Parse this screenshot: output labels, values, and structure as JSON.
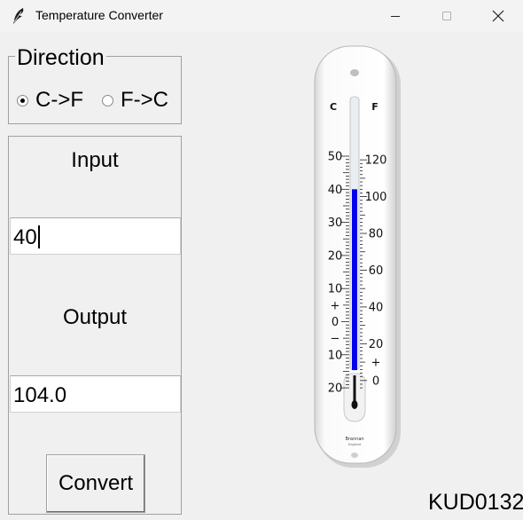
{
  "window": {
    "title": "Temperature Converter",
    "icon": "feather-icon",
    "controls": [
      "minimize-icon",
      "maximize-icon",
      "close-icon"
    ]
  },
  "direction": {
    "legend": "Direction",
    "options": [
      {
        "label": "C->F",
        "checked": true
      },
      {
        "label": "F->C",
        "checked": false
      }
    ]
  },
  "input": {
    "label": "Input",
    "value": "40"
  },
  "output": {
    "label": "Output",
    "value": "104.0"
  },
  "convert_button": {
    "label": "Convert"
  },
  "thermometer": {
    "celsius_unit": "C",
    "fahrenheit_unit": "F",
    "celsius_ticks": [
      "50",
      "40",
      "30",
      "20",
      "10",
      "+",
      "0",
      "−",
      "10",
      "20"
    ],
    "fahrenheit_ticks": [
      "120",
      "100",
      "80",
      "60",
      "40",
      "20",
      "+",
      "0"
    ],
    "brand": "Brannan",
    "brand_sub": "England",
    "mercury_color": "#0000ee",
    "reading_celsius": 40
  },
  "footer_code": "KUD0132"
}
